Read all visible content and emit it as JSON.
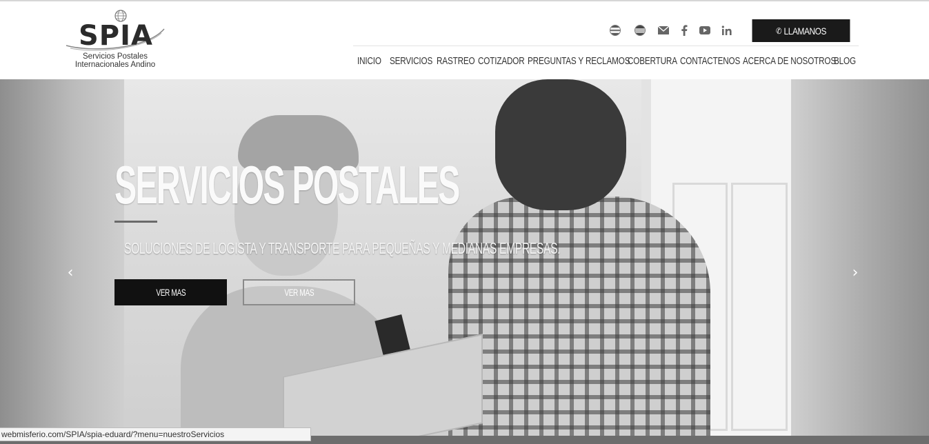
{
  "header": {
    "logo": {
      "name": "SPIA",
      "tagline_1": "Servicios Postales",
      "tagline_2": "Internacionales Andino"
    },
    "social_icons": [
      "us-flag-icon",
      "spain-flag-icon",
      "envelope-icon",
      "facebook-icon",
      "youtube-icon",
      "linkedin-icon"
    ],
    "call_button": "LLAMANOS",
    "nav": [
      "INICIO",
      "SERVICIOS",
      "RASTREO",
      "COTIZADOR",
      "PREGUNTAS Y RECLAMOS",
      "COBERTURA",
      "CONTACTENOS",
      "ACERCA DE NOSOTROS",
      "BLOG"
    ]
  },
  "hero": {
    "title": "SERVICIOS POSTALES",
    "subtitle": "SOLUCIONES DE LOGISTA Y TRANSPORTE PARA PEQUEÑAS Y MEDIANAS EMPRESAS.",
    "button_primary": "VER MAS",
    "button_secondary": "VER MAS",
    "prev_arrow": "‹",
    "next_arrow": "›"
  },
  "status_bar": {
    "url": "webmisferio.com/SPIA/spia-eduard/?menu=nuestroServicios"
  },
  "colors": {
    "call_button_bg": "#1a1a1a",
    "primary_button_bg": "#111111",
    "nav_text": "#333333"
  }
}
